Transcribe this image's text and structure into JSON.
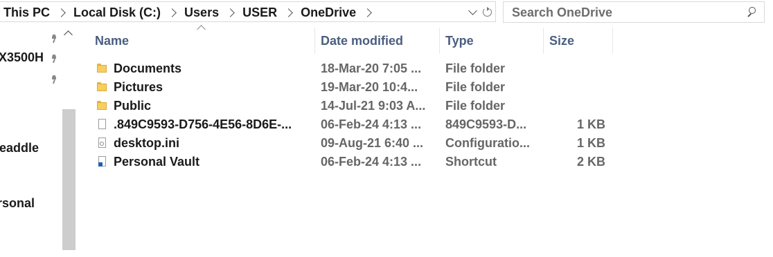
{
  "breadcrumb": [
    "This PC",
    "Local Disk (C:)",
    "Users",
    "USER",
    "OneDrive"
  ],
  "search": {
    "placeholder": "Search OneDrive"
  },
  "nav": {
    "items": [
      {
        "label": ""
      },
      {
        "label": "X3500H"
      },
      {
        "label": ""
      },
      {
        "label": "eaddle"
      },
      {
        "label": "rsonal"
      }
    ]
  },
  "columns": {
    "name": "Name",
    "date": "Date modified",
    "type": "Type",
    "size": "Size"
  },
  "files": [
    {
      "name": "Documents",
      "date": "18-Mar-20 7:05 ...",
      "type": "File folder",
      "size": "",
      "icon": "folder-icon"
    },
    {
      "name": "Pictures",
      "date": "19-Mar-20 10:4...",
      "type": "File folder",
      "size": "",
      "icon": "folder-icon"
    },
    {
      "name": "Public",
      "date": "14-Jul-21 9:03 A...",
      "type": "File folder",
      "size": "",
      "icon": "folder-icon"
    },
    {
      "name": ".849C9593-D756-4E56-8D6E-...",
      "date": "06-Feb-24 4:13 ...",
      "type": "849C9593-D...",
      "size": "1 KB",
      "icon": "file-icon"
    },
    {
      "name": "desktop.ini",
      "date": "09-Aug-21 6:40 ...",
      "type": "Configuratio...",
      "size": "1 KB",
      "icon": "settings-file-icon"
    },
    {
      "name": "Personal Vault",
      "date": "06-Feb-24 4:13 ...",
      "type": "Shortcut",
      "size": "2 KB",
      "icon": "shortcut-icon"
    }
  ]
}
